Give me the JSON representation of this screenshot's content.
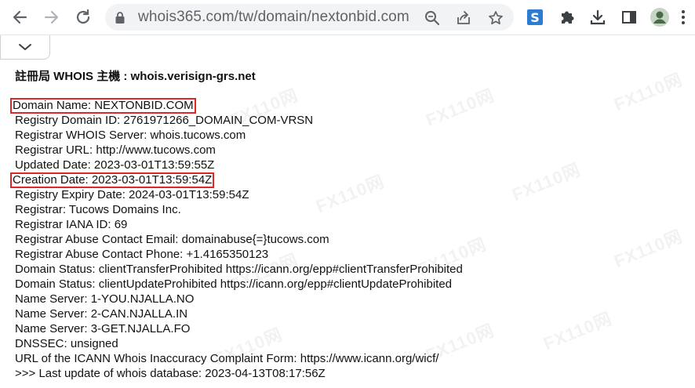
{
  "browser": {
    "url": "whois365.com/tw/domain/nextonbid.com",
    "icons": [
      "back-arrow-icon",
      "forward-arrow-icon",
      "reload-icon",
      "lock-icon",
      "zoom-icon",
      "share-icon",
      "bookmark-star-icon",
      "extension-s-icon",
      "puzzle-icon",
      "download-icon",
      "side-panel-icon",
      "profile-avatar-icon",
      "kebab-menu-icon",
      "chevron-down-icon"
    ]
  },
  "page": {
    "heading_prefix": "註冊局",
    "heading_whois": " WHOIS ",
    "heading_host": "主機",
    "heading_server": " : whois.verisign-grs.net",
    "lines": [
      "Domain Name: NEXTONBID.COM",
      "Registry Domain ID: 2761971266_DOMAIN_COM-VRSN",
      "Registrar WHOIS Server: whois.tucows.com",
      "Registrar URL: http://www.tucows.com",
      "Updated Date: 2023-03-01T13:59:55Z",
      "Creation Date: 2023-03-01T13:59:54Z",
      "Registry Expiry Date: 2024-03-01T13:59:54Z",
      "Registrar: Tucows Domains Inc.",
      "Registrar IANA ID: 69",
      "Registrar Abuse Contact Email: domainabuse{=}tucows.com",
      "Registrar Abuse Contact Phone: +1.4165350123",
      "Domain Status: clientTransferProhibited https://icann.org/epp#clientTransferProhibited",
      "Domain Status: clientUpdateProhibited https://icann.org/epp#clientUpdateProhibited",
      "Name Server: 1-YOU.NJALLA.NO",
      "Name Server: 2-CAN.NJALLA.IN",
      "Name Server: 3-GET.NJALLA.FO",
      "DNSSEC: unsigned",
      "URL of the ICANN Whois Inaccuracy Complaint Form: https://www.icann.org/wicf/",
      ">>> Last update of whois database: 2023-04-13T08:17:56Z"
    ]
  },
  "watermark": "FX110网",
  "colors": {
    "highlight": "#e0262b",
    "accent": "#1a73e8"
  }
}
